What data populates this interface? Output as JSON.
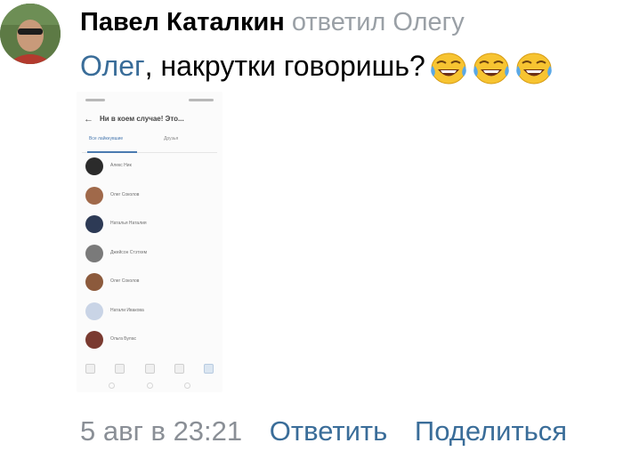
{
  "comment": {
    "author": "Павел Каталкин",
    "replied_to": "ответил Олегу",
    "mention": "Олег",
    "text": ", накрутки говоришь?",
    "emojis": [
      "face-with-tears-of-joy",
      "face-with-tears-of-joy",
      "face-with-tears-of-joy"
    ],
    "date": "5 авг в 23:21",
    "reply_label": "Ответить",
    "share_label": "Поделиться"
  },
  "attachment": {
    "title": "Ни в коем случае! Это...",
    "tabs": [
      "Все лайкнувшие",
      "Друзья"
    ],
    "people": [
      {
        "name": "Алекс Ник",
        "avatar_color": "#2b2b2b"
      },
      {
        "name": "Олег Соколов",
        "avatar_color": "#a0694a"
      },
      {
        "name": "Наталья Наталия",
        "avatar_color": "#2d3a55"
      },
      {
        "name": "Джейсон Стэтхем",
        "avatar_color": "#7a7a7a"
      },
      {
        "name": "Олег Соколов",
        "avatar_color": "#8c5a3c"
      },
      {
        "name": "Натали Ивакова",
        "avatar_color": "#c9d4e6"
      },
      {
        "name": "Ольга Булас",
        "avatar_color": "#7a3a30"
      }
    ]
  },
  "colors": {
    "link": "#3a6d99",
    "muted": "#8a8f96",
    "tab_active": "#4a7ab0"
  }
}
